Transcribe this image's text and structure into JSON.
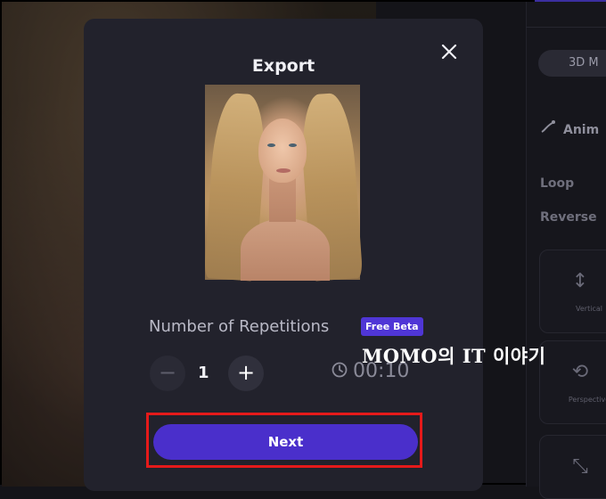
{
  "modal": {
    "title": "Export",
    "close_icon": "close-icon"
  },
  "repetitions": {
    "label": "Number of Repetitions",
    "badge": "Free Beta",
    "value": "1",
    "minus_icon": "minus-icon",
    "plus_icon": "plus-icon"
  },
  "duration": {
    "text": "00:10",
    "icon": "clock-icon"
  },
  "next_button": {
    "label": "Next"
  },
  "right_panel": {
    "mode_pill": "3D M",
    "anim_label": "Anim",
    "loop_label": "Loop",
    "reverse_label": "Reverse",
    "cards": [
      {
        "label": "Vertical",
        "icon": "vertical-arrows-icon"
      },
      {
        "label": "Perspective",
        "icon": "perspective-icon"
      },
      {
        "label": "",
        "icon": "shrink-icon"
      }
    ]
  },
  "watermark": {
    "text": "MOMO의 IT 이야기"
  },
  "colors": {
    "accent": "#4a2fcb",
    "badge": "#4f36d6",
    "highlight_box": "#e51a1a",
    "modal_bg": "#22222c"
  }
}
